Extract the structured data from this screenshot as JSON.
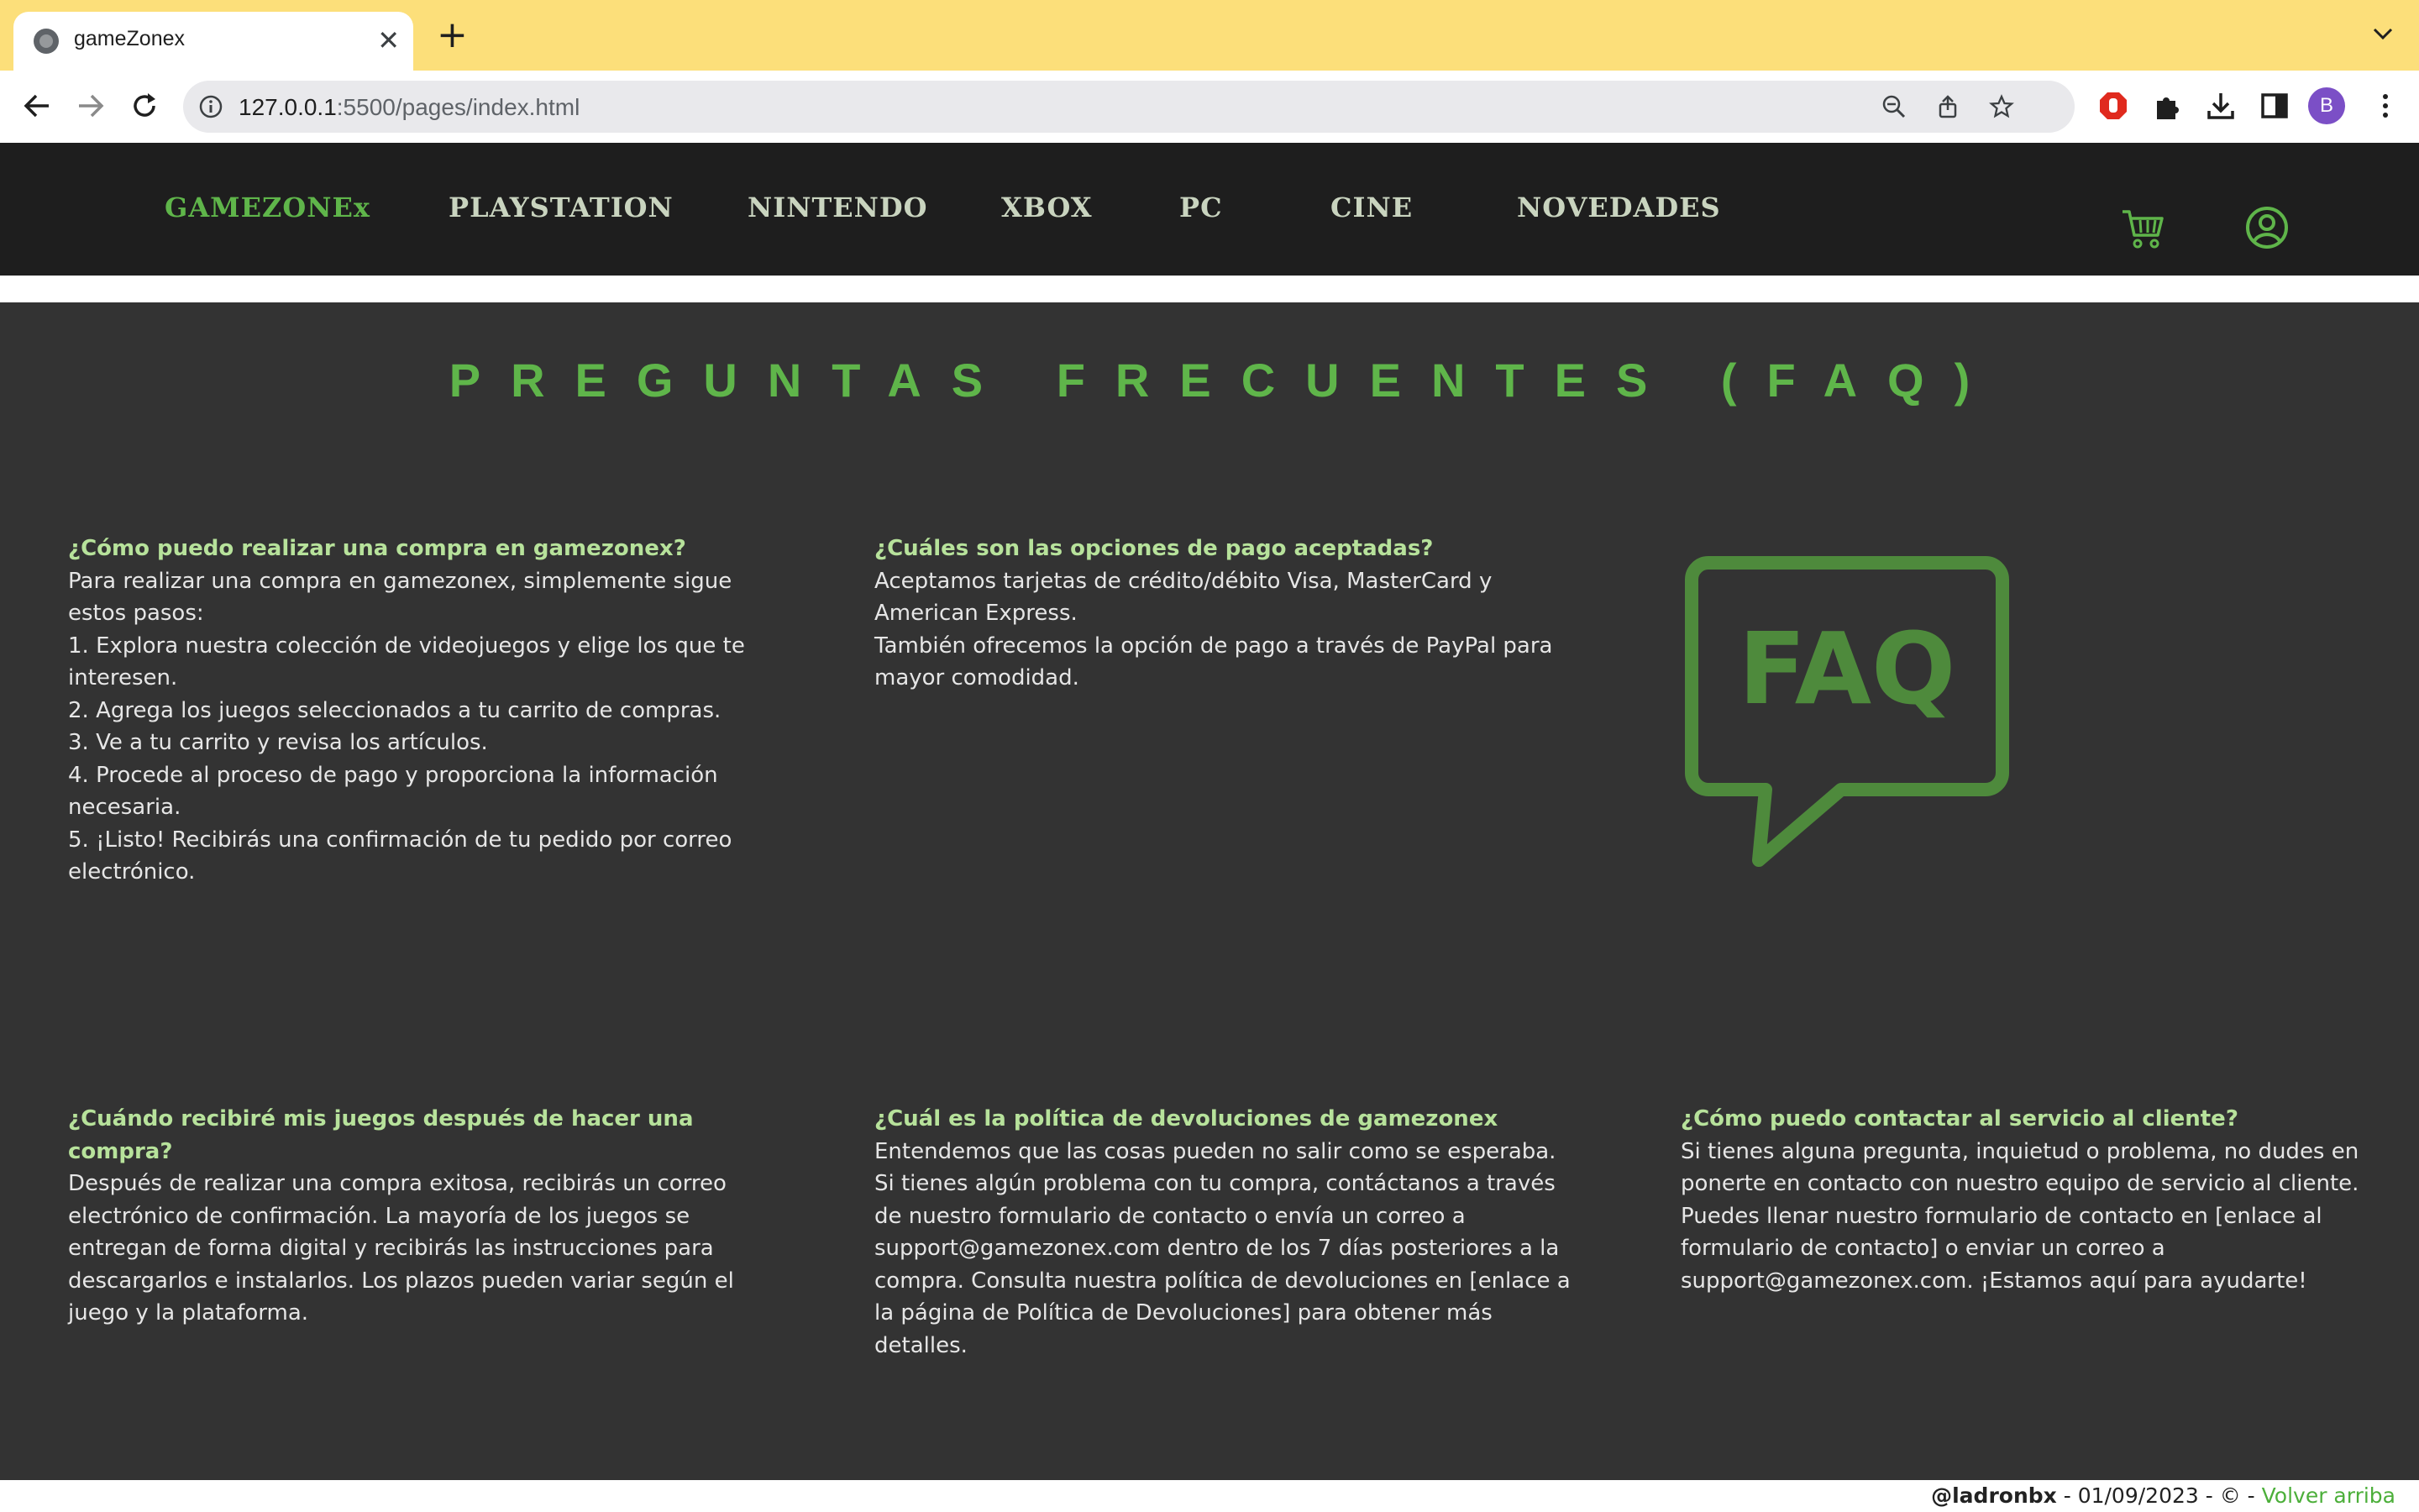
{
  "browser": {
    "tab_title": "gameZonex",
    "tab_close": "✕",
    "new_tab": "+",
    "url_host": "127.0.0.1",
    "url_rest": ":5500/pages/index.html",
    "profile_initial": "B"
  },
  "nav": {
    "brand": "GAMEZONEx",
    "links": [
      "PLAYSTATION",
      "NINTENDO",
      "XBOX",
      "PC",
      "CINE",
      "NOVEDADES"
    ],
    "accent_color": "#5fb54a"
  },
  "faq": {
    "title": "PREGUNTAS FRECUENTES (FAQ)",
    "illustration_label": "FAQ",
    "items": [
      {
        "question": "¿Cómo puedo realizar una compra en gamezonex?",
        "answer": "Para realizar una compra en gamezonex, simplemente sigue estos pasos:\n1. Explora nuestra colección de videojuegos y elige los que te interesen.\n2. Agrega los juegos seleccionados a tu carrito de compras.\n3. Ve a tu carrito y revisa los artículos.\n4. Procede al proceso de pago y proporciona la información necesaria.\n5. ¡Listo! Recibirás una confirmación de tu pedido por correo electrónico."
      },
      {
        "question": "¿Cuáles son las opciones de pago aceptadas?",
        "answer": "Aceptamos tarjetas de crédito/débito Visa, MasterCard y American Express.\nTambién ofrecemos la opción de pago a través de PayPal para mayor comodidad."
      },
      {
        "question": "¿Cuándo recibiré mis juegos después de hacer una compra?",
        "answer": "Después de realizar una compra exitosa, recibirás un correo electrónico de confirmación. La mayoría de los juegos se entregan de forma digital y recibirás las instrucciones para descargarlos e instalarlos. Los plazos pueden variar según el juego y la plataforma."
      },
      {
        "question": "¿Cuál es la política de devoluciones de gamezonex",
        "answer": "Entendemos que las cosas pueden no salir como se esperaba. Si tienes algún problema con tu compra, contáctanos a través de nuestro formulario de contacto o envía un correo a support@gamezonex.com dentro de los 7 días posteriores a la compra. Consulta nuestra política de devoluciones en [enlace a la página de Política de Devoluciones] para obtener más detalles."
      },
      {
        "question": "¿Cómo puedo contactar al servicio al cliente?",
        "answer": "Si tienes alguna pregunta, inquietud o problema, no dudes en ponerte en contacto con nuestro equipo de servicio al cliente. Puedes llenar nuestro formulario de contacto en [enlace al formulario de contacto] o enviar un correo a support@gamezonex.com. ¡Estamos aquí para ayudarte!"
      }
    ]
  },
  "footer": {
    "author": "@ladronbx",
    "middle": " - 01/09/2023 - © - ",
    "back_to_top": "Volver arriba"
  }
}
